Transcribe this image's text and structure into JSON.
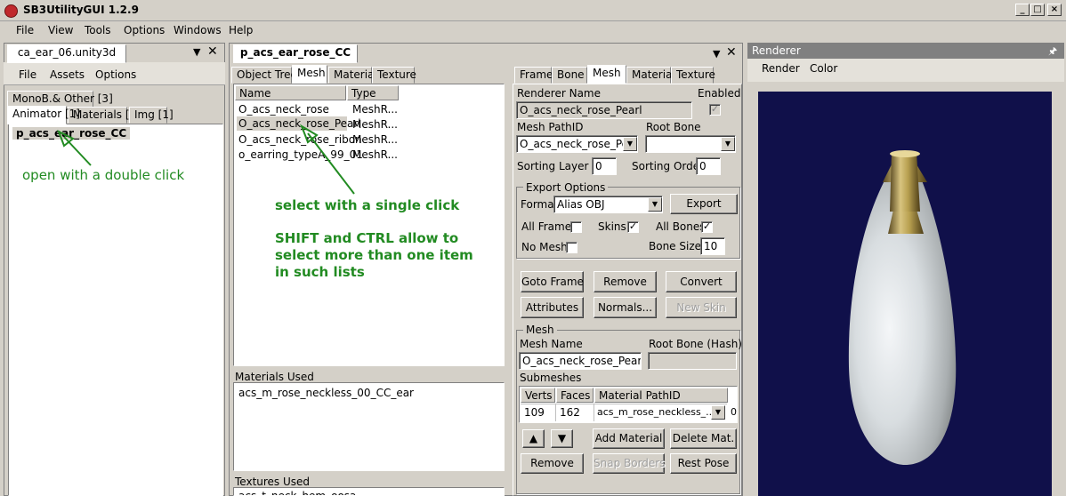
{
  "window": {
    "title": "SB3UtilityGUI 1.2.9",
    "controls": [
      "_",
      "□",
      "×"
    ]
  },
  "menubar": [
    "File",
    "View",
    "Tools",
    "Options",
    "Windows",
    "Help"
  ],
  "left": {
    "doc_tab": "ca_ear_06.unity3d",
    "menu": [
      "File",
      "Assets",
      "Options"
    ],
    "tabs_row1": [
      "MonoB.& Other [3]"
    ],
    "tabs_row2": [
      "Animator [1]",
      "Materials [2]",
      "Img [1]"
    ],
    "tree_item": "p_acs_ear_rose_CC",
    "hint": "open with a double click"
  },
  "middle": {
    "doc_tab": "p_acs_ear_rose_CC",
    "tabs": [
      "Object Tree",
      "Mesh",
      "Material",
      "Texture"
    ],
    "columns": [
      "Name",
      "Type"
    ],
    "rows": [
      {
        "name": "O_acs_neck_rose",
        "type": "MeshR..."
      },
      {
        "name": "O_acs_neck_rose_Pearl",
        "type": "MeshR..."
      },
      {
        "name": "O_acs_neck_rose_ribon",
        "type": "MeshR..."
      },
      {
        "name": "o_earring_typeA_99_01",
        "type": "MeshR..."
      }
    ],
    "hint1": "select with a single click",
    "hint2": [
      "SHIFT and CTRL allow to",
      "select more than one item",
      "in such lists"
    ],
    "materials_label": "Materials Used",
    "material_item": "acs_m_rose_neckless_00_CC_ear",
    "textures_label": "Textures Used",
    "texture_item": "acs_t_neck_hem_oosa"
  },
  "editor": {
    "tabs": [
      "Frame",
      "Bone",
      "Mesh",
      "Material",
      "Texture"
    ],
    "renderer_name_label": "Renderer Name",
    "renderer_name": "O_acs_neck_rose_Pearl",
    "enabled_label": "Enabled",
    "mesh_pathid_label": "Mesh PathID",
    "mesh_pathid": "O_acs_neck_rose_Pearl",
    "root_bone_label": "Root Bone",
    "root_bone": "",
    "sorting_layer_label": "Sorting Layer ID",
    "sorting_layer": "0",
    "sorting_order_label": "Sorting Order",
    "sorting_order": "0",
    "export_group": "Export Options",
    "format_label": "Format",
    "format_value": "Alias OBJ",
    "export_btn": "Export",
    "all_frames": "All Frames",
    "skins": "Skins",
    "all_bones": "All Bones",
    "no_mesh": "No Mesh",
    "bone_size_label": "Bone Size",
    "bone_size": "10",
    "buttons1": [
      "Goto Frame",
      "Remove",
      "Convert"
    ],
    "buttons2": [
      "Attributes",
      "Normals...",
      "New Skin"
    ],
    "mesh_group": "Mesh",
    "mesh_name_label": "Mesh Name",
    "mesh_name": "O_acs_neck_rose_Pearl",
    "root_bone_hash_label": "Root Bone (Hash)",
    "root_bone_hash": "",
    "submeshes_label": "Submeshes",
    "sub_cols": [
      "Verts",
      "Faces",
      "Material PathID"
    ],
    "sub_row": {
      "verts": "109",
      "faces": "162",
      "material": "acs_m_rose_neckless_...",
      "extra": "0"
    },
    "up": "▲",
    "down": "▼",
    "add_material": "Add Material",
    "delete_mat": "Delete Mat.",
    "remove2": "Remove",
    "snap_borders": "Snap Borders",
    "rest_pose": "Rest Pose"
  },
  "renderer": {
    "title": "Renderer",
    "pin": "🖈",
    "menu": [
      "Render",
      "Color"
    ],
    "bg_color": "#10104a"
  },
  "accent": {
    "hint_green": "#228b22",
    "selection": "#d4d0c8"
  }
}
